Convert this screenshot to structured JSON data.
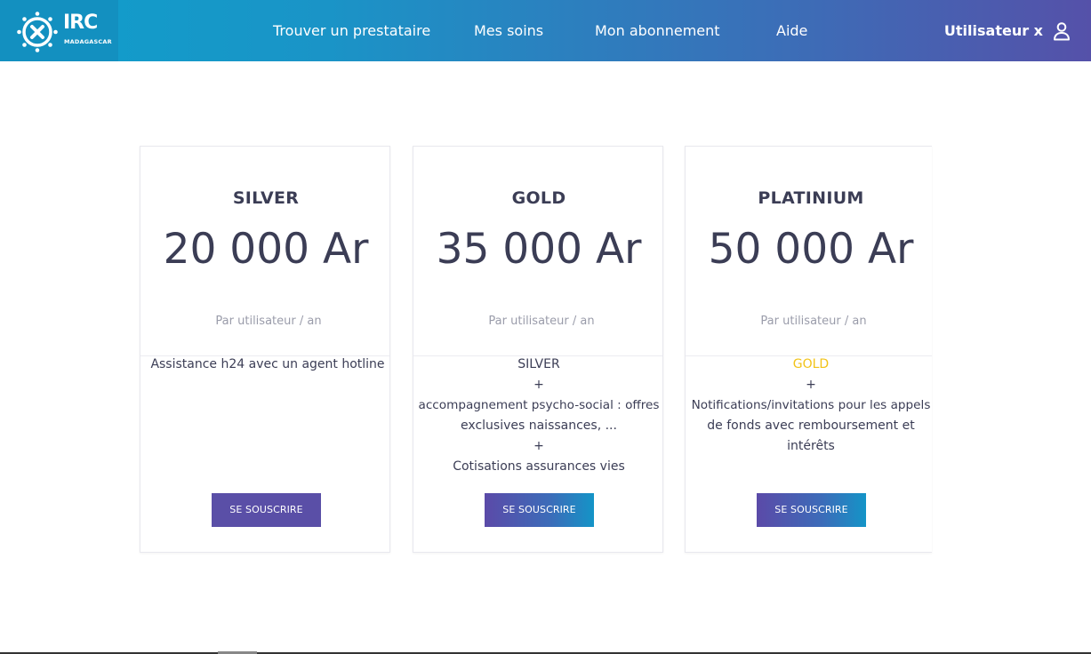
{
  "header": {
    "logo": {
      "title": "IRC",
      "subtitle": "MADAGASCAR"
    },
    "nav": [
      {
        "label": "Trouver un prestataire"
      },
      {
        "label": "Mes soins"
      },
      {
        "label": "Mon abonnement"
      },
      {
        "label": "Aide"
      }
    ],
    "user": {
      "name": "Utilisateur x",
      "icon": "user-icon"
    }
  },
  "plans": [
    {
      "name": "SILVER",
      "price": "20 000 Ar",
      "period": "Par utilisateur / an",
      "features": [
        "Assistance h24 avec un agent hotline"
      ],
      "button": "SE SOUSCRIRE"
    },
    {
      "name": "GOLD",
      "price": "35 000 Ar",
      "period": "Par utilisateur / an",
      "features": [
        "SILVER",
        "+",
        "accompagnement psycho-social : offres",
        "exclusives naissances, ...",
        "+",
        "Cotisations assurances vies"
      ],
      "button": "SE SOUSCRIRE"
    },
    {
      "name": "PLATINIUM",
      "price": "50 000 Ar",
      "period": "Par utilisateur / an",
      "features": [
        "GOLD",
        "+",
        "Notifications/invitations pour les appels",
        "de fonds avec remboursement et",
        "intérêts"
      ],
      "button": "SE SOUSCRIRE"
    }
  ],
  "colors": {
    "header_gradient_start": "#0f9fcb",
    "header_gradient_end": "#5551a9",
    "text_dark": "#3b3d55",
    "text_muted": "#9a9caa",
    "gold_highlight": "#f2c318",
    "button_purple": "#5a4fa7",
    "button_blue": "#1494c7"
  }
}
